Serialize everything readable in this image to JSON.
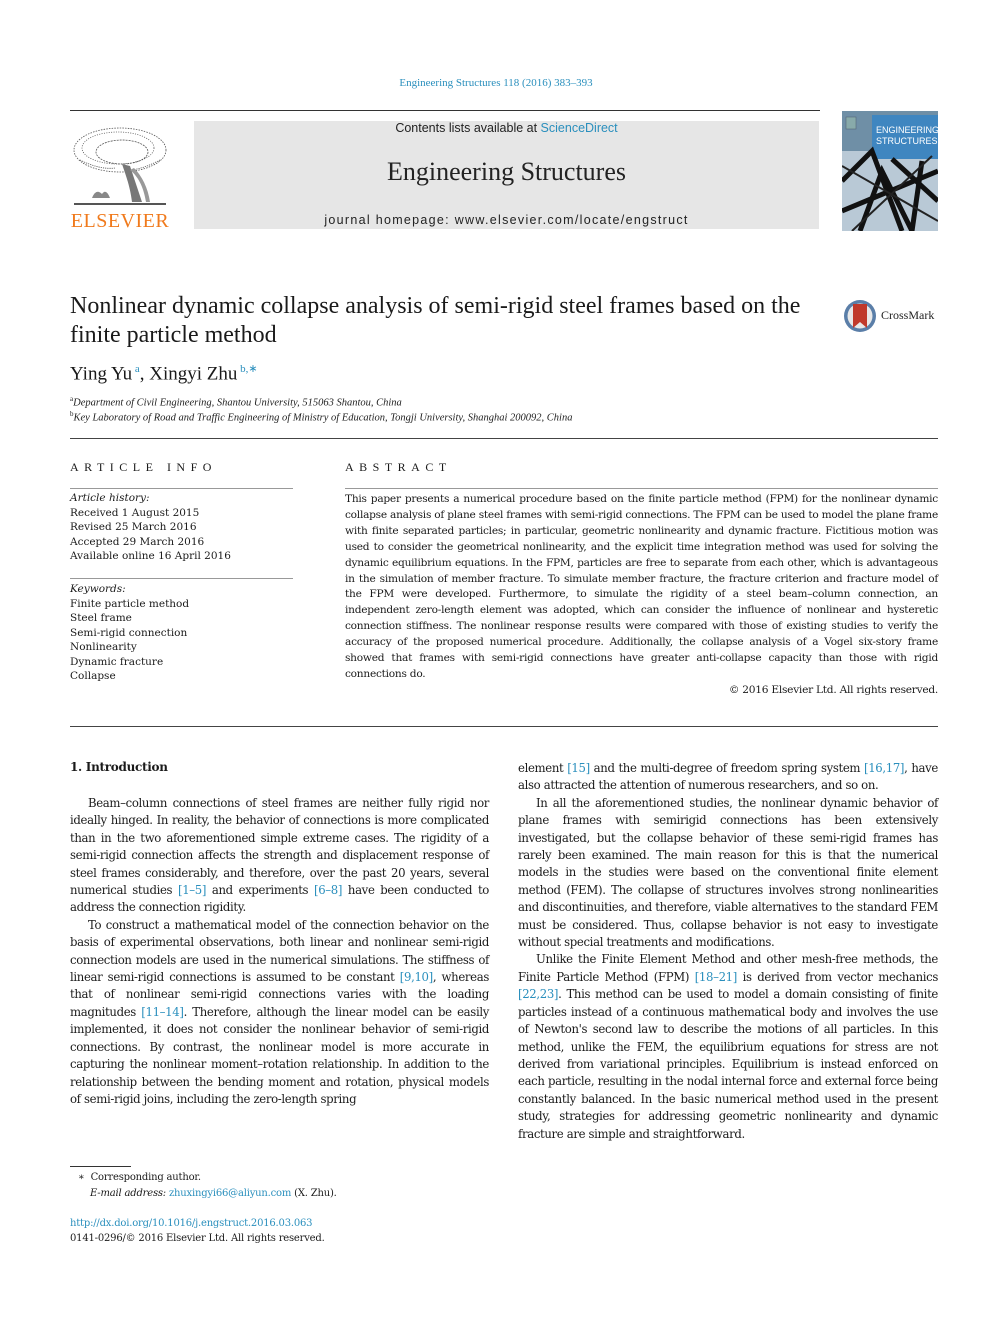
{
  "header": {
    "journal_ref": "Engineering Structures 118 (2016) 383–393",
    "contents_prefix": "Contents lists available at ",
    "contents_link": "ScienceDirect",
    "journal_title": "Engineering Structures",
    "homepage": "journal homepage: www.elsevier.com/locate/engstruct",
    "publisher_wordmark": "ELSEVIER",
    "cover_title_line1": "ENGINEERING",
    "cover_title_line2": "STRUCTURES",
    "crossmark_label": "CrossMark"
  },
  "article": {
    "title": "Nonlinear dynamic collapse analysis of semi-rigid steel frames based on the finite particle method",
    "authors": [
      {
        "name": "Ying Yu",
        "marks": "a"
      },
      {
        "name": "Xingyi Zhu",
        "marks": "b,∗"
      }
    ],
    "affiliations": [
      {
        "mark": "a",
        "text": "Department of Civil Engineering, Shantou University, 515063 Shantou, China"
      },
      {
        "mark": "b",
        "text": "Key Laboratory of Road and Traffic Engineering of Ministry of Education, Tongji University, Shanghai 200092, China"
      }
    ]
  },
  "article_info": {
    "heading": "ARTICLE INFO",
    "history_label": "Article history:",
    "history": [
      "Received 1 August 2015",
      "Revised 25 March 2016",
      "Accepted 29 March 2016",
      "Available online 16 April 2016"
    ],
    "keywords_label": "Keywords:",
    "keywords": [
      "Finite particle method",
      "Steel frame",
      "Semi-rigid connection",
      "Nonlinearity",
      "Dynamic fracture",
      "Collapse"
    ]
  },
  "abstract": {
    "heading": "ABSTRACT",
    "text": "This paper presents a numerical procedure based on the finite particle method (FPM) for the nonlinear dynamic collapse analysis of plane steel frames with semi-rigid connections. The FPM can be used to model the plane frame with finite separated particles; in particular, geometric nonlinearity and dynamic fracture. Fictitious motion was used to consider the geometrical nonlinearity, and the explicit time integration method was used for solving the dynamic equilibrium equations. In the FPM, particles are free to separate from each other, which is advantageous in the simulation of member fracture. To simulate member fracture, the fracture criterion and fracture model of the FPM were developed. Furthermore, to simulate the rigidity of a steel beam–column connection, an independent zero-length element was adopted, which can consider the influence of nonlinear and hysteretic connection stiffness. The nonlinear response results were compared with those of existing studies to verify the accuracy of the proposed numerical procedure. Additionally, the collapse analysis of a Vogel six-story frame showed that frames with semi-rigid connections have greater anti-collapse capacity than those with rigid connections do.",
    "copyright": "© 2016 Elsevier Ltd. All rights reserved."
  },
  "body": {
    "section_heading": "1. Introduction",
    "left_paragraphs": [
      [
        {
          "t": "Beam–column connections of steel frames are neither fully rigid nor ideally hinged. In reality, the behavior of connections is more complicated than in the two aforementioned simple extreme cases. The rigidity of a semi-rigid connection affects the strength and displacement response of steel frames considerably, and therefore, over the past 20 years, several numerical studies "
        },
        {
          "c": "[1–5]"
        },
        {
          "t": " and experiments "
        },
        {
          "c": "[6–8]"
        },
        {
          "t": " have been conducted to address the connection rigidity."
        }
      ],
      [
        {
          "t": "To construct a mathematical model of the connection behavior on the basis of experimental observations, both linear and nonlinear semi-rigid connection models are used in the numerical simulations. The stiffness of linear semi-rigid connections is assumed to be constant "
        },
        {
          "c": "[9,10]"
        },
        {
          "t": ", whereas that of nonlinear semi-rigid connections varies with the loading magnitudes "
        },
        {
          "c": "[11–14]"
        },
        {
          "t": ". Therefore, although the linear model can be easily implemented, it does not consider the nonlinear behavior of semi-rigid connections. By contrast, the nonlinear model is more accurate in capturing the nonlinear moment–rotation relationship. In addition to the relationship between the bending moment and rotation, physical models of semi-rigid joins, including the zero-length spring"
        }
      ]
    ],
    "right_paragraphs": [
      [
        {
          "t": "element "
        },
        {
          "c": "[15]"
        },
        {
          "t": " and the multi-degree of freedom spring system "
        },
        {
          "c": "[16,17]"
        },
        {
          "t": ", have also attracted the attention of numerous researchers, and so on."
        }
      ],
      [
        {
          "t": "In all the aforementioned studies, the nonlinear dynamic behavior of plane frames with semirigid connections has been extensively investigated, but the collapse behavior of these semi-rigid frames has rarely been examined. The main reason for this is that the numerical models in the studies were based on the conventional finite element method (FEM). The collapse of structures involves strong nonlinearities and discontinuities, and therefore, viable alternatives to the standard FEM must be considered. Thus, collapse behavior is not easy to investigate without special treatments and modifications."
        }
      ],
      [
        {
          "t": "Unlike the Finite Element Method and other mesh-free methods, the Finite Particle Method (FPM) "
        },
        {
          "c": "[18–21]"
        },
        {
          "t": " is derived from vector mechanics "
        },
        {
          "c": "[22,23]"
        },
        {
          "t": ". This method can be used to model a domain consisting of finite particles instead of a continuous mathematical body and involves the use of Newton's second law to describe the motions of all particles. In this method, unlike the FEM, the equilibrium equations for stress are not derived from variational principles. Equilibrium is instead enforced on each particle, resulting in the nodal internal force and external force being constantly balanced. In the basic numerical method used in the present study, strategies for addressing geometric nonlinearity and dynamic fracture are simple and straightforward."
        }
      ]
    ]
  },
  "footnotes": {
    "corresponding_mark": "∗",
    "corresponding_text": "Corresponding author.",
    "email_label": "E-mail address:",
    "email": "zhuxingyi66@aliyun.com",
    "email_suffix": "(X. Zhu).",
    "doi": "http://dx.doi.org/10.1016/j.engstruct.2016.03.063",
    "issn_copyright": "0141-0296/© 2016 Elsevier Ltd. All rights reserved."
  },
  "colors": {
    "link": "#2a8fbd",
    "elsevier_orange": "#f07a1c",
    "masthead_bg": "#e6e6e6",
    "cover_blue": "#3f86c0"
  }
}
